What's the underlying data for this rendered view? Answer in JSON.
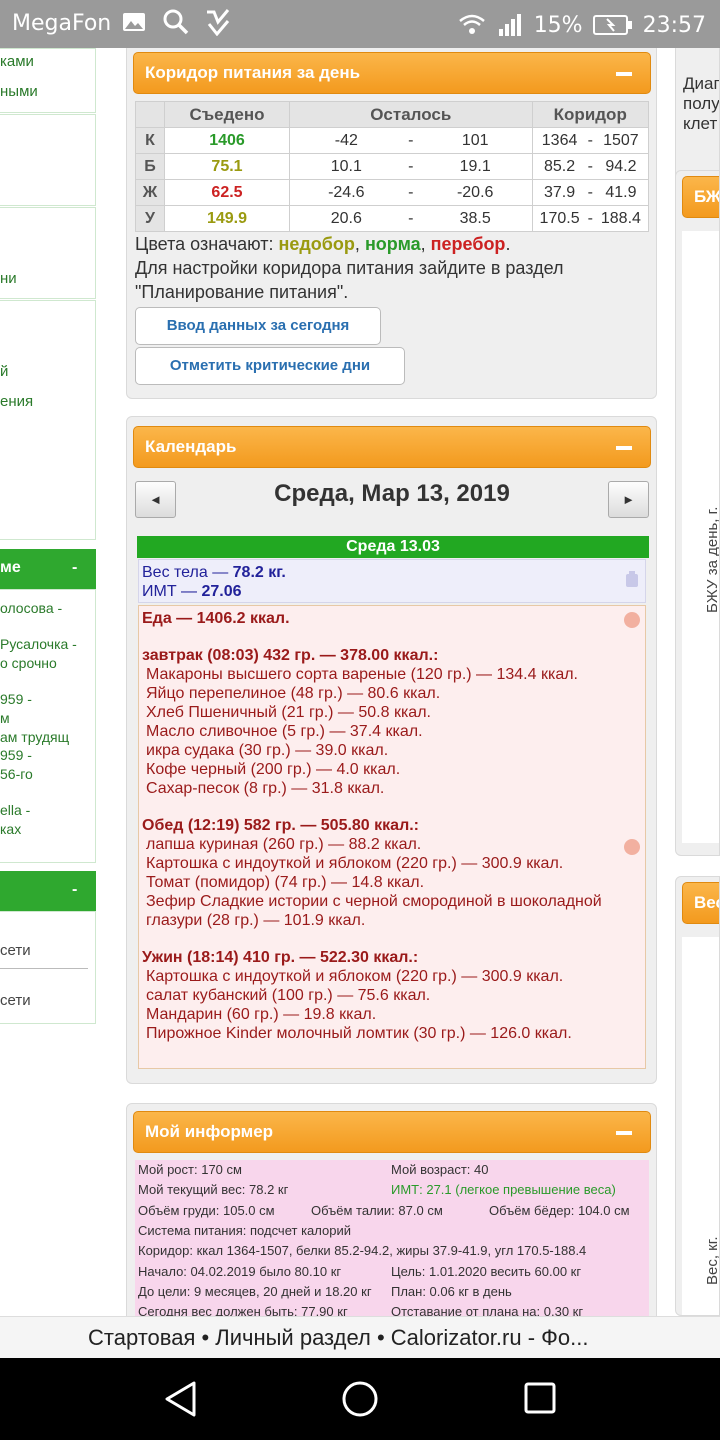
{
  "statusbar": {
    "carrier": "MegaFon",
    "battery": "15%",
    "time": "23:57"
  },
  "left_sidebar": {
    "top_links": [
      "ками",
      "ными"
    ],
    "item_ni": "ни",
    "item_y": "й",
    "item_eniya": "ения",
    "green_header_1": "ме",
    "green_header_1_toggle": "-",
    "list": [
      "олосова -",
      "Русалочка -",
      "о срочно",
      "959 -",
      "м",
      "ам трудящ",
      "959 -",
      "56-го",
      "ella -",
      "ках"
    ],
    "green_header_2_toggle": "-",
    "net_items": [
      "сети",
      "сети"
    ]
  },
  "corridor": {
    "header": "Коридор питания за день",
    "col_eaten": "Съедено",
    "col_left": "Осталось",
    "col_corridor": "Коридор",
    "rows": [
      {
        "label": "К",
        "eaten": "1406",
        "cls": "g",
        "l1": "-42",
        "l2": "101",
        "c1": "1364",
        "c2": "1507"
      },
      {
        "label": "Б",
        "eaten": "75.1",
        "cls": "o",
        "l1": "10.1",
        "l2": "19.1",
        "c1": "85.2",
        "c2": "94.2"
      },
      {
        "label": "Ж",
        "eaten": "62.5",
        "cls": "r",
        "l1": "-24.6",
        "l2": "-20.6",
        "c1": "37.9",
        "c2": "41.9"
      },
      {
        "label": "У",
        "eaten": "149.9",
        "cls": "o",
        "l1": "20.6",
        "l2": "38.5",
        "c1": "170.5",
        "c2": "188.4"
      }
    ],
    "dash": "-",
    "legend_prefix": "Цвета означают: ",
    "legend_under": "недобор",
    "legend_norm": "норма",
    "legend_over": "перебор",
    "legend_sep": ", ",
    "legend_end": ".",
    "setup_text": "Для настройки коридора питания зайдите в раздел \"Планирование питания\".",
    "btn_input": "Ввод данных за сегодня",
    "btn_critical": "Отметить критические дни"
  },
  "calendar": {
    "header": "Календарь",
    "prev": "◄",
    "next": "►",
    "title": "Среда, Мар 13, 2019",
    "day_bar": "Среда 13.03",
    "weight_label": "Вес тела — ",
    "weight_value": "78.2 кг.",
    "bmi_label": "ИМТ — ",
    "bmi_value": "27.06",
    "food_total": "Еда — 1406.2 ккал.",
    "meals": [
      {
        "title": "завтрак (08:03) 432 гр. — 378.00 ккал.:",
        "items": [
          "Макароны высшего сорта вареные (120 гр.) — 134.4 ккал.",
          "Яйцо перепелиное (48 гр.) — 80.6 ккал.",
          "Хлеб Пшеничный (21 гр.) — 50.8 ккал.",
          "Масло сливочное (5 гр.) — 37.4 ккал.",
          "икра судака (30 гр.) — 39.0 ккал.",
          "Кофе черный (200 гр.) — 4.0 ккал.",
          "Сахар-песок (8 гр.) — 31.8 ккал."
        ]
      },
      {
        "title": "Обед (12:19) 582 гр. — 505.80 ккал.:",
        "items": [
          "лапша куриная (260 гр.) — 88.2 ккал.",
          "Картошка с индоуткой и яблоком (220 гр.) — 300.9 ккал.",
          "Томат (помидор) (74 гр.) — 14.8 ккал.",
          "Зефир Сладкие истории с черной смородиной в шоколадной глазури (28 гр.) — 101.9 ккал."
        ]
      },
      {
        "title": "Ужин (18:14) 410 гр. — 522.30 ккал.:",
        "items": [
          "Картошка с индоуткой и яблоком (220 гр.) — 300.9 ккал.",
          "салат кубанский (100 гр.) — 75.6 ккал.",
          "Мандарин (60 гр.) — 19.8 ккал.",
          "Пирожное Kinder молочный ломтик (30 гр.) — 126.0 ккал."
        ]
      }
    ]
  },
  "informer": {
    "header": "Мой информер",
    "height": "Мой рост: 170 см",
    "age": "Мой возраст: 40",
    "weight": "Мой текущий вес: 78.2 кг",
    "bmi": "ИМТ: 27.1 (легкое превышение веса)",
    "chest": "Объём груди: 105.0 см",
    "waist": "Объём талии: 87.0 см",
    "hips": "Объём бёдер: 104.0 см",
    "system": "Система питания: подсчет калорий",
    "corridor": "Коридор: ккал 1364-1507, белки 85.2-94.2, жиры 37.9-41.9, угл 170.5-188.4",
    "start": "Начало: 04.02.2019 было 80.10 кг",
    "goal": "Цель: 1.01.2020 весить 60.00 кг",
    "to_goal": "До цели: 9 месяцев, 20 дней и 18.20 кг",
    "plan": "План: 0.06 кг в день",
    "today_left": "Сегодня вес должен быть: 77.90 кг",
    "lag": "Отставание от плана на: 0.30 кг"
  },
  "right_column": {
    "text_lines": [
      "Диаг",
      "полу",
      "клет"
    ],
    "header_bzhu": "БЖ",
    "vertical_bzhu": "БЖУ за день, г.",
    "header_weight": "Вес",
    "vertical_weight": "Вес, кг."
  },
  "bottom_bar": {
    "text": "Стартовая • Личный раздел • Calorizator.ru - Фо..."
  }
}
